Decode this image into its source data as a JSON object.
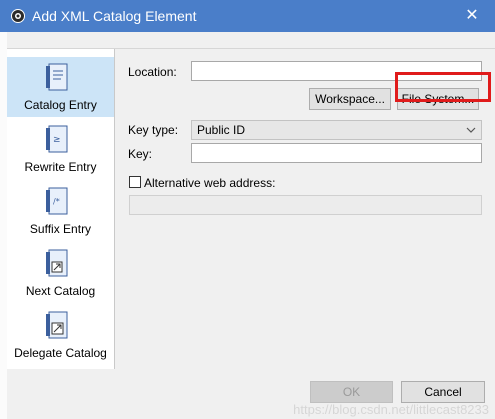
{
  "window": {
    "title": "Add XML Catalog Element",
    "close_glyph": "✕"
  },
  "sidebar": {
    "items": [
      {
        "label": "Catalog Entry",
        "icon": "catalog-entry-icon",
        "selected": true
      },
      {
        "label": "Rewrite Entry",
        "icon": "rewrite-entry-icon",
        "selected": false
      },
      {
        "label": "Suffix Entry",
        "icon": "suffix-entry-icon",
        "selected": false
      },
      {
        "label": "Next Catalog",
        "icon": "next-catalog-icon",
        "selected": false
      },
      {
        "label": "Delegate Catalog",
        "icon": "delegate-catalog-icon",
        "selected": false
      }
    ]
  },
  "form": {
    "location_label": "Location:",
    "location_value": "",
    "workspace_button": "Workspace...",
    "file_system_button": "File System...",
    "key_type_label": "Key type:",
    "key_type_value": "Public ID",
    "key_label": "Key:",
    "key_value": "",
    "alt_web_address_label": "Alternative web address:",
    "alt_web_address_checked": false,
    "alt_web_address_value": ""
  },
  "footer": {
    "ok_button": "OK",
    "cancel_button": "Cancel"
  },
  "watermark": "https://blog.csdn.net/littlecast8233",
  "colors": {
    "titlebar": "#4a7ec9",
    "selection": "#cce4f7",
    "highlight": "#e01b1b"
  }
}
